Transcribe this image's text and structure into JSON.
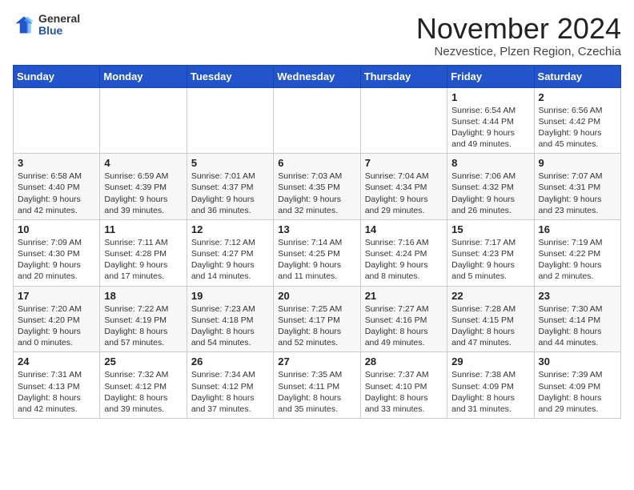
{
  "logo": {
    "general": "General",
    "blue": "Blue"
  },
  "title": "November 2024",
  "location": "Nezvestice, Plzen Region, Czechia",
  "days_of_week": [
    "Sunday",
    "Monday",
    "Tuesday",
    "Wednesday",
    "Thursday",
    "Friday",
    "Saturday"
  ],
  "weeks": [
    [
      {
        "day": "",
        "info": ""
      },
      {
        "day": "",
        "info": ""
      },
      {
        "day": "",
        "info": ""
      },
      {
        "day": "",
        "info": ""
      },
      {
        "day": "",
        "info": ""
      },
      {
        "day": "1",
        "info": "Sunrise: 6:54 AM\nSunset: 4:44 PM\nDaylight: 9 hours\nand 49 minutes."
      },
      {
        "day": "2",
        "info": "Sunrise: 6:56 AM\nSunset: 4:42 PM\nDaylight: 9 hours\nand 45 minutes."
      }
    ],
    [
      {
        "day": "3",
        "info": "Sunrise: 6:58 AM\nSunset: 4:40 PM\nDaylight: 9 hours\nand 42 minutes."
      },
      {
        "day": "4",
        "info": "Sunrise: 6:59 AM\nSunset: 4:39 PM\nDaylight: 9 hours\nand 39 minutes."
      },
      {
        "day": "5",
        "info": "Sunrise: 7:01 AM\nSunset: 4:37 PM\nDaylight: 9 hours\nand 36 minutes."
      },
      {
        "day": "6",
        "info": "Sunrise: 7:03 AM\nSunset: 4:35 PM\nDaylight: 9 hours\nand 32 minutes."
      },
      {
        "day": "7",
        "info": "Sunrise: 7:04 AM\nSunset: 4:34 PM\nDaylight: 9 hours\nand 29 minutes."
      },
      {
        "day": "8",
        "info": "Sunrise: 7:06 AM\nSunset: 4:32 PM\nDaylight: 9 hours\nand 26 minutes."
      },
      {
        "day": "9",
        "info": "Sunrise: 7:07 AM\nSunset: 4:31 PM\nDaylight: 9 hours\nand 23 minutes."
      }
    ],
    [
      {
        "day": "10",
        "info": "Sunrise: 7:09 AM\nSunset: 4:30 PM\nDaylight: 9 hours\nand 20 minutes."
      },
      {
        "day": "11",
        "info": "Sunrise: 7:11 AM\nSunset: 4:28 PM\nDaylight: 9 hours\nand 17 minutes."
      },
      {
        "day": "12",
        "info": "Sunrise: 7:12 AM\nSunset: 4:27 PM\nDaylight: 9 hours\nand 14 minutes."
      },
      {
        "day": "13",
        "info": "Sunrise: 7:14 AM\nSunset: 4:25 PM\nDaylight: 9 hours\nand 11 minutes."
      },
      {
        "day": "14",
        "info": "Sunrise: 7:16 AM\nSunset: 4:24 PM\nDaylight: 9 hours\nand 8 minutes."
      },
      {
        "day": "15",
        "info": "Sunrise: 7:17 AM\nSunset: 4:23 PM\nDaylight: 9 hours\nand 5 minutes."
      },
      {
        "day": "16",
        "info": "Sunrise: 7:19 AM\nSunset: 4:22 PM\nDaylight: 9 hours\nand 2 minutes."
      }
    ],
    [
      {
        "day": "17",
        "info": "Sunrise: 7:20 AM\nSunset: 4:20 PM\nDaylight: 9 hours\nand 0 minutes."
      },
      {
        "day": "18",
        "info": "Sunrise: 7:22 AM\nSunset: 4:19 PM\nDaylight: 8 hours\nand 57 minutes."
      },
      {
        "day": "19",
        "info": "Sunrise: 7:23 AM\nSunset: 4:18 PM\nDaylight: 8 hours\nand 54 minutes."
      },
      {
        "day": "20",
        "info": "Sunrise: 7:25 AM\nSunset: 4:17 PM\nDaylight: 8 hours\nand 52 minutes."
      },
      {
        "day": "21",
        "info": "Sunrise: 7:27 AM\nSunset: 4:16 PM\nDaylight: 8 hours\nand 49 minutes."
      },
      {
        "day": "22",
        "info": "Sunrise: 7:28 AM\nSunset: 4:15 PM\nDaylight: 8 hours\nand 47 minutes."
      },
      {
        "day": "23",
        "info": "Sunrise: 7:30 AM\nSunset: 4:14 PM\nDaylight: 8 hours\nand 44 minutes."
      }
    ],
    [
      {
        "day": "24",
        "info": "Sunrise: 7:31 AM\nSunset: 4:13 PM\nDaylight: 8 hours\nand 42 minutes."
      },
      {
        "day": "25",
        "info": "Sunrise: 7:32 AM\nSunset: 4:12 PM\nDaylight: 8 hours\nand 39 minutes."
      },
      {
        "day": "26",
        "info": "Sunrise: 7:34 AM\nSunset: 4:12 PM\nDaylight: 8 hours\nand 37 minutes."
      },
      {
        "day": "27",
        "info": "Sunrise: 7:35 AM\nSunset: 4:11 PM\nDaylight: 8 hours\nand 35 minutes."
      },
      {
        "day": "28",
        "info": "Sunrise: 7:37 AM\nSunset: 4:10 PM\nDaylight: 8 hours\nand 33 minutes."
      },
      {
        "day": "29",
        "info": "Sunrise: 7:38 AM\nSunset: 4:09 PM\nDaylight: 8 hours\nand 31 minutes."
      },
      {
        "day": "30",
        "info": "Sunrise: 7:39 AM\nSunset: 4:09 PM\nDaylight: 8 hours\nand 29 minutes."
      }
    ]
  ]
}
